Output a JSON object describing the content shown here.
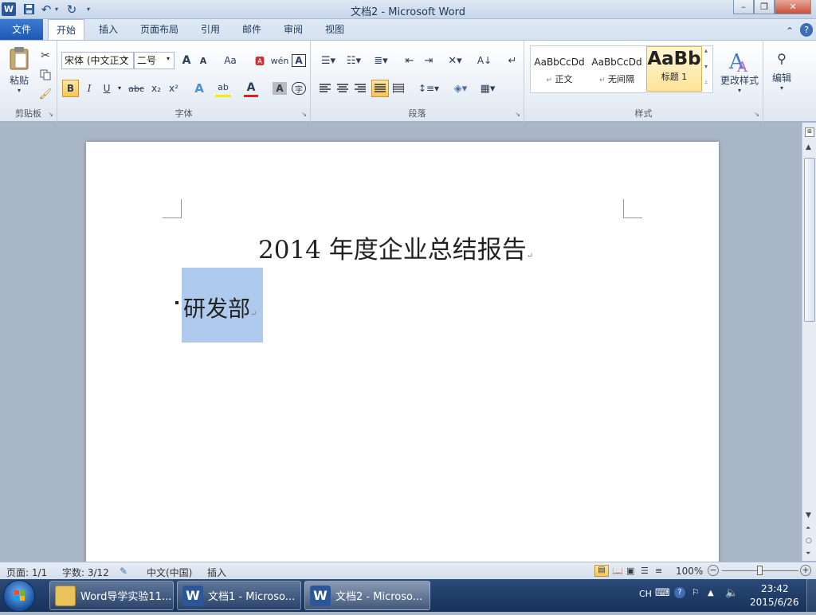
{
  "window": {
    "title": "文档2 - Microsoft Word",
    "app_icon": "W",
    "minimize": "–",
    "maximize": "❐",
    "close": "✕"
  },
  "ribbon_tabs": [
    "文件",
    "开始",
    "插入",
    "页面布局",
    "引用",
    "邮件",
    "审阅",
    "视图"
  ],
  "ribbon": {
    "clipboard": {
      "paste": "粘贴",
      "label": "剪贴板"
    },
    "font": {
      "font_name": "宋体 (中文正文",
      "font_size": "二号",
      "bold": "B",
      "italic": "I",
      "underline": "U",
      "strike": "abc",
      "sub": "x₂",
      "sup": "x²",
      "grow": "A",
      "shrink": "A",
      "case": "Aa",
      "label": "字体"
    },
    "paragraph": {
      "label": "段落"
    },
    "styles": {
      "items": [
        {
          "preview": "AaBbCcDd",
          "name": "正文"
        },
        {
          "preview": "AaBbCcDd",
          "name": "无间隔"
        },
        {
          "preview": "AaBb",
          "name": "标题 1"
        }
      ],
      "change_styles": "更改样式",
      "label": "样式"
    },
    "editing": {
      "label": "编辑"
    }
  },
  "document": {
    "title": "2014 年度企业总结报告",
    "heading": "研发部"
  },
  "status": {
    "page": "页面: 1/1",
    "words": "字数: 3/12",
    "language": "中文(中国)",
    "mode": "插入",
    "zoom": "100%"
  },
  "taskbar": {
    "items": [
      {
        "label": "Word导学实验11...",
        "icon": "folder-icon"
      },
      {
        "label": "文档1 - Microso...",
        "icon": "word-icon"
      },
      {
        "label": "文档2 - Microso...",
        "icon": "word-icon"
      }
    ],
    "lang": "CH",
    "time": "23:42",
    "date": "2015/6/26"
  },
  "colors": {
    "accent": "#2b579a",
    "selection": "#aecbee",
    "file_tab": "#1d59b4"
  }
}
